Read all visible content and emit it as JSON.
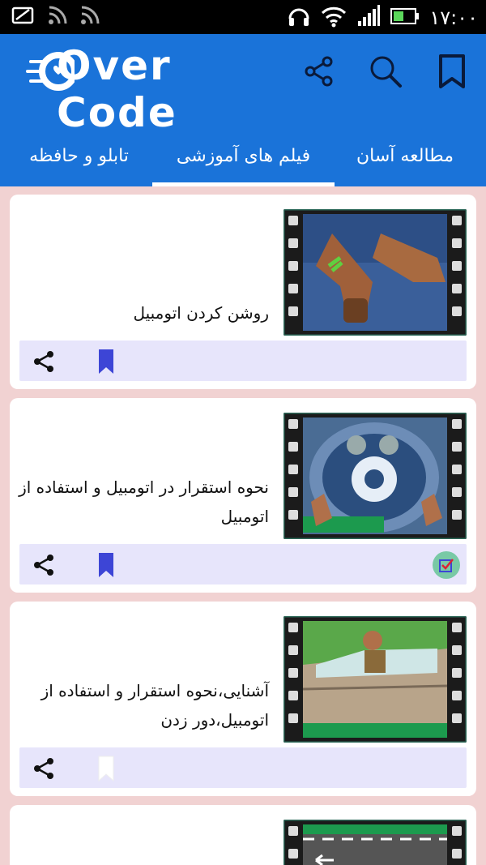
{
  "status_bar": {
    "time": "۱۷:۰۰"
  },
  "app": {
    "logo_text": "Over Code"
  },
  "header_icons": [
    "share-icon",
    "search-icon",
    "bookmark-icon"
  ],
  "tabs": [
    {
      "label": "مطالعه آسان",
      "selected": false
    },
    {
      "label": "فیلم های آموزشی",
      "selected": true
    },
    {
      "label": "تابلو و حافظه",
      "selected": false
    }
  ],
  "videos": [
    {
      "title": "روشن کردن اتومبیل",
      "bookmarked": true,
      "watched": false
    },
    {
      "title": "نحوه استقرار در اتومبیل و استفاده از اتومبیل",
      "bookmarked": true,
      "watched": true
    },
    {
      "title": "آشنایی،نحوه استقرار و استفاده از اتومبیل،دور زدن",
      "bookmarked": false,
      "watched": false
    },
    {
      "title": "",
      "bookmarked": false,
      "watched": false
    }
  ],
  "colors": {
    "primary": "#1a73d9",
    "background": "#f1d2d2",
    "action_bar": "#e7e5fb",
    "bookmark": "#3d45d6",
    "watched_badge": "#79c9a6"
  }
}
